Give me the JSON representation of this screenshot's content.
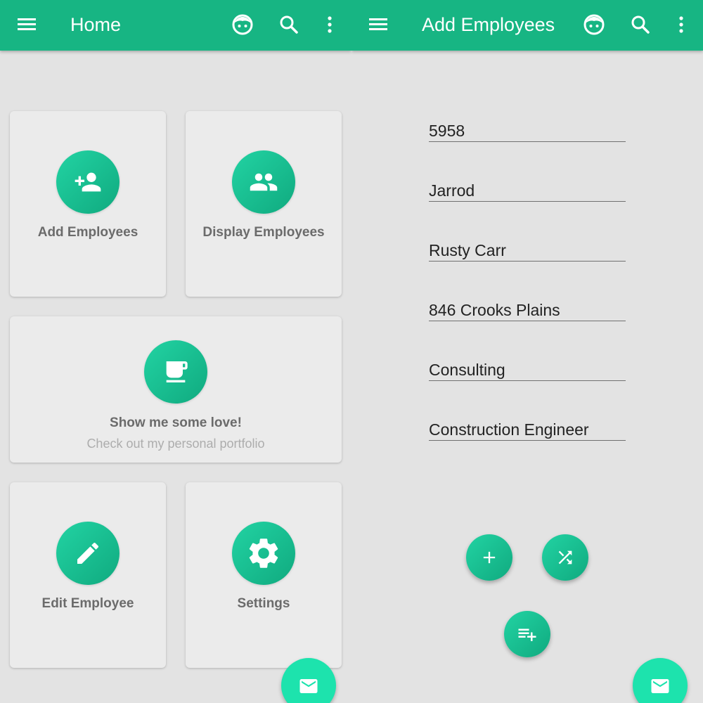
{
  "theme": {
    "primary": "#17b583",
    "accent": "#1de3ad",
    "background": "#e3e3e3",
    "card": "#ebebeb"
  },
  "home": {
    "appbar": {
      "title": "Home",
      "icons": [
        "menu-icon",
        "face-icon",
        "search-icon",
        "more-vert-icon"
      ]
    },
    "cards": {
      "add": {
        "label": "Add Employees",
        "icon": "person-add-icon"
      },
      "display": {
        "label": "Display Employees",
        "icon": "people-icon"
      },
      "love": {
        "label": "Show me some love!",
        "sub": "Check out my personal portfolio",
        "icon": "coffee-cup-icon"
      },
      "edit": {
        "label": "Edit Employee",
        "icon": "pencil-icon"
      },
      "settings": {
        "label": "Settings",
        "icon": "gear-icon"
      }
    },
    "fab": {
      "icon": "mail-icon"
    }
  },
  "add_employees": {
    "appbar": {
      "title": "Add Employees",
      "icons": [
        "menu-icon",
        "face-icon",
        "search-icon",
        "more-vert-icon"
      ]
    },
    "fields": {
      "id": "5958",
      "first_name": "Jarrod",
      "last_name": "Rusty Carr",
      "address": "846 Crooks Plains",
      "department": "Consulting",
      "position": "Construction Engineer"
    },
    "buttons": {
      "add": "add-icon",
      "shuffle": "shuffle-icon",
      "playlist_add": "playlist-add-icon",
      "mail": "mail-icon"
    }
  }
}
